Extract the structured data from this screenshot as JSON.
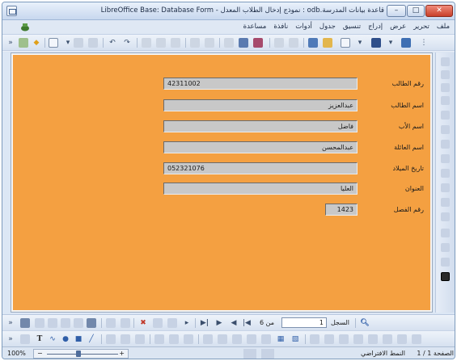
{
  "window": {
    "title": "قاعدة بيانات المدرسة.odb : نموذج إدخال الطلاب المعدل - LibreOffice Base: Database Form",
    "minimize": "–",
    "maximize": "□",
    "close": "✕"
  },
  "menu": [
    "ملف",
    "تحرير",
    "عرض",
    "إدراج",
    "تنسيق",
    "جدول",
    "أدوات",
    "نافذة",
    "مساعدة"
  ],
  "form": {
    "background": "#f4a041",
    "fields": [
      {
        "label": "رقم الطالب",
        "value": "42311002"
      },
      {
        "label": "اسم الطالب",
        "value": "عبدالعزيز"
      },
      {
        "label": "اسم الأب",
        "value": "فاضل"
      },
      {
        "label": "اسم العائلة",
        "value": "عبدالمحسن"
      },
      {
        "label": "تاريخ الميلاد",
        "value": "052321076"
      },
      {
        "label": "العنوان",
        "value": "العليا"
      },
      {
        "label": "رقم الفصل",
        "value": "1423"
      }
    ]
  },
  "navigation": {
    "record_label": "السجل",
    "record_value": "1",
    "of_label": "من 6"
  },
  "status": {
    "zoom": "100%",
    "page": "الصفحة 1 / 1",
    "style": "النمط الافتراضي"
  }
}
